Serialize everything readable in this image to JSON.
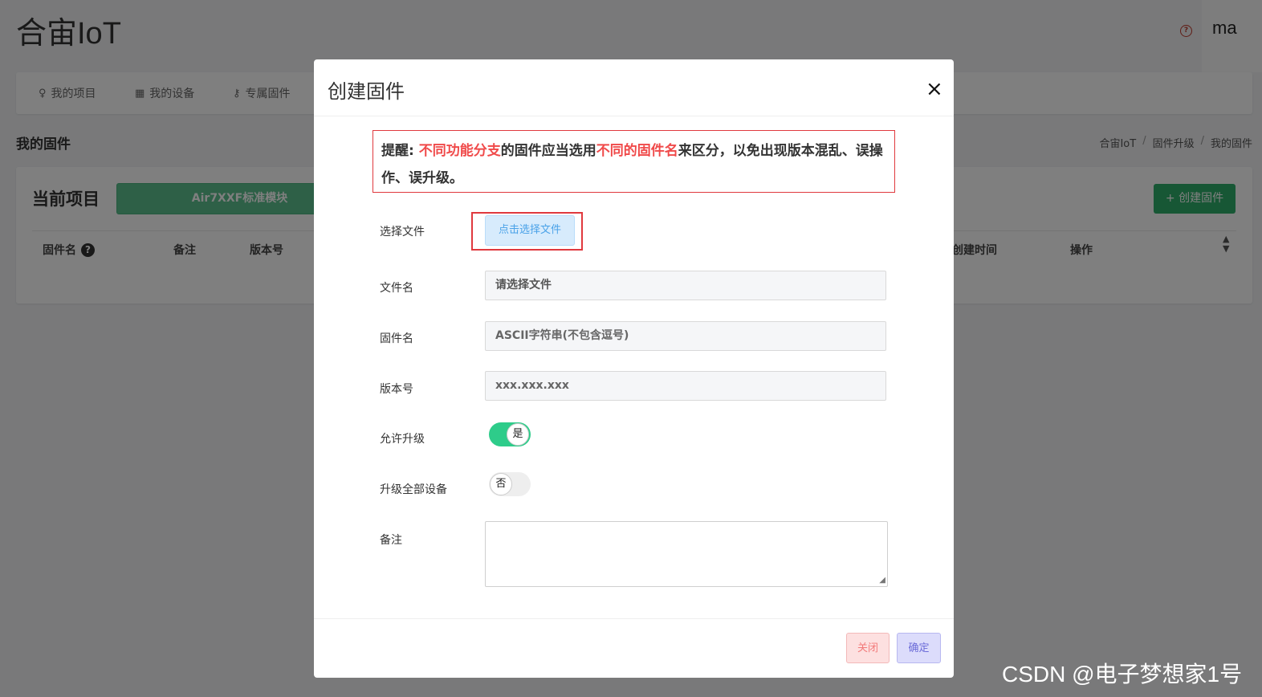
{
  "app": {
    "title": "合宙IoT",
    "help_icon": "?",
    "user": "ma"
  },
  "nav": [
    {
      "label": "我的项目",
      "icon": "bulb-icon",
      "glyph": "♀"
    },
    {
      "label": "我的设备",
      "icon": "chip-icon",
      "glyph": "▦"
    },
    {
      "label": "专属固件",
      "icon": "key-icon",
      "glyph": "⚷"
    }
  ],
  "page": {
    "section_title": "我的固件",
    "breadcrumb": [
      "合宙IoT",
      "固件升级",
      "我的固件"
    ],
    "breadcrumb_sep": "/"
  },
  "card": {
    "current_label": "当前项目",
    "project_name": "Air7XXF标准模块",
    "create_button": "+ 创建固件",
    "columns": [
      "固件名",
      "备注",
      "版本号",
      "创建时间",
      "操作"
    ],
    "qmark": "?",
    "sort_up": "▲",
    "sort_down": "▼"
  },
  "modal": {
    "title": "创建固件",
    "close": "×",
    "notice": {
      "prefix": "提醒: ",
      "red1": "不同功能分支",
      "mid": "的固件应当选用",
      "red2": "不同的固件名",
      "suffix": "来区分，以免出现版本混乱、误操作、误升级。"
    },
    "fields": {
      "select_file_label": "选择文件",
      "select_file_button": "点击选择文件",
      "filename_label": "文件名",
      "filename_value": "请选择文件",
      "firmware_label": "固件名",
      "firmware_placeholder": "ASCII字符串(不包含逗号)",
      "version_label": "版本号",
      "version_placeholder": "xxx.xxx.xxx",
      "allow_upgrade_label": "允许升级",
      "allow_upgrade_value": "是",
      "upgrade_all_label": "升级全部设备",
      "upgrade_all_value": "否",
      "remark_label": "备注"
    },
    "buttons": {
      "close": "关闭",
      "ok": "确定"
    }
  },
  "watermark": "CSDN @电子梦想家1号",
  "colors": {
    "overlay": "rgba(0,0,0,0.5)",
    "accent_green": "#2fae6b",
    "toggle_on": "#2ecc8a",
    "notice_red": "#f04a4a"
  }
}
